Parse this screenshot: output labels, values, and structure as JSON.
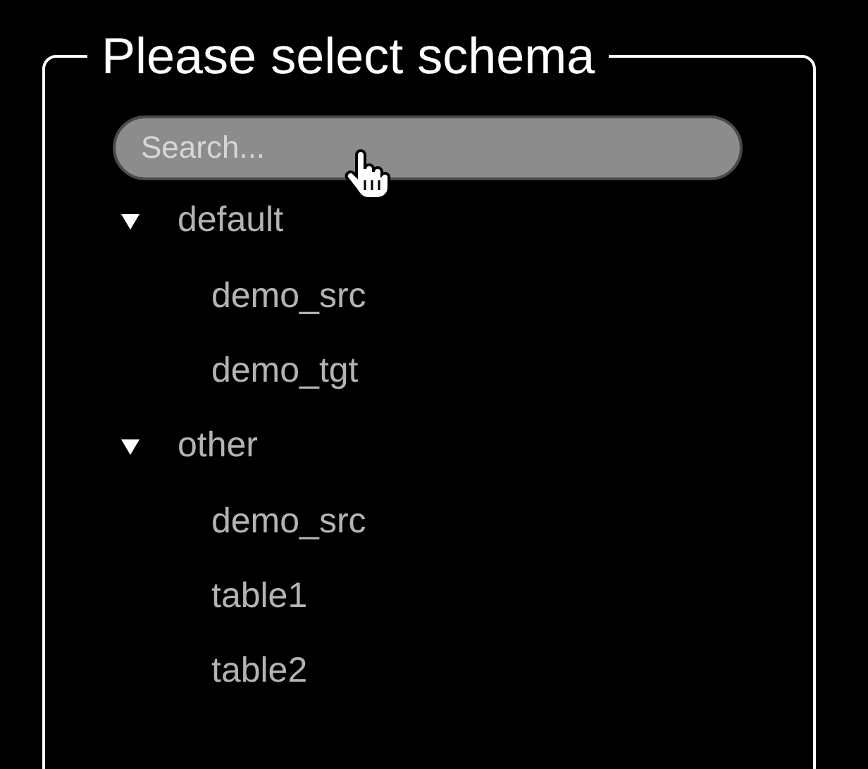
{
  "title": "Please select schema",
  "search": {
    "placeholder": "Search..."
  },
  "tree": [
    {
      "label": "default",
      "expanded": true,
      "children": [
        {
          "label": "demo_src"
        },
        {
          "label": "demo_tgt"
        }
      ]
    },
    {
      "label": "other",
      "expanded": true,
      "children": [
        {
          "label": "demo_src"
        },
        {
          "label": "table1"
        },
        {
          "label": "table2"
        }
      ]
    }
  ]
}
